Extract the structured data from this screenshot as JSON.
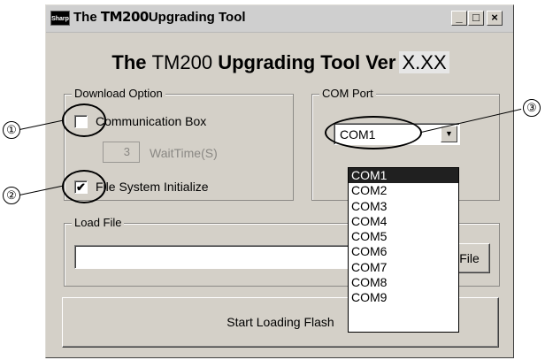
{
  "window": {
    "app_icon_text": "Sharp",
    "title_prefix": "The ",
    "title_model": "TM200",
    "title_suffix": "Upgrading Tool",
    "minimize_glyph": "_",
    "maximize_glyph": "□",
    "close_glyph": "×"
  },
  "heading": {
    "the": "The ",
    "model": "TM200",
    "rest": " Upgrading Tool Ver",
    "version": "X.XX"
  },
  "download_option": {
    "label": "Download Option",
    "communication_box": {
      "label": "Communication Box",
      "checked": false
    },
    "wait_time": {
      "value": "3",
      "label": "WaitTime(S)"
    },
    "file_system_init": {
      "label": "File System Initialize",
      "checked": true,
      "check_glyph": "✔"
    }
  },
  "com_port": {
    "label": "COM Port",
    "selected": "COM1",
    "arrow_glyph": "▼",
    "options": [
      "COM1",
      "COM2",
      "COM3",
      "COM4",
      "COM5",
      "COM6",
      "COM7",
      "COM8",
      "COM9"
    ]
  },
  "load_file": {
    "label": "Load File",
    "path_value": "",
    "button_label": "File"
  },
  "start_button": {
    "label": "Start Loading Flash"
  },
  "callouts": {
    "one": "①",
    "two": "②",
    "three": "③"
  }
}
